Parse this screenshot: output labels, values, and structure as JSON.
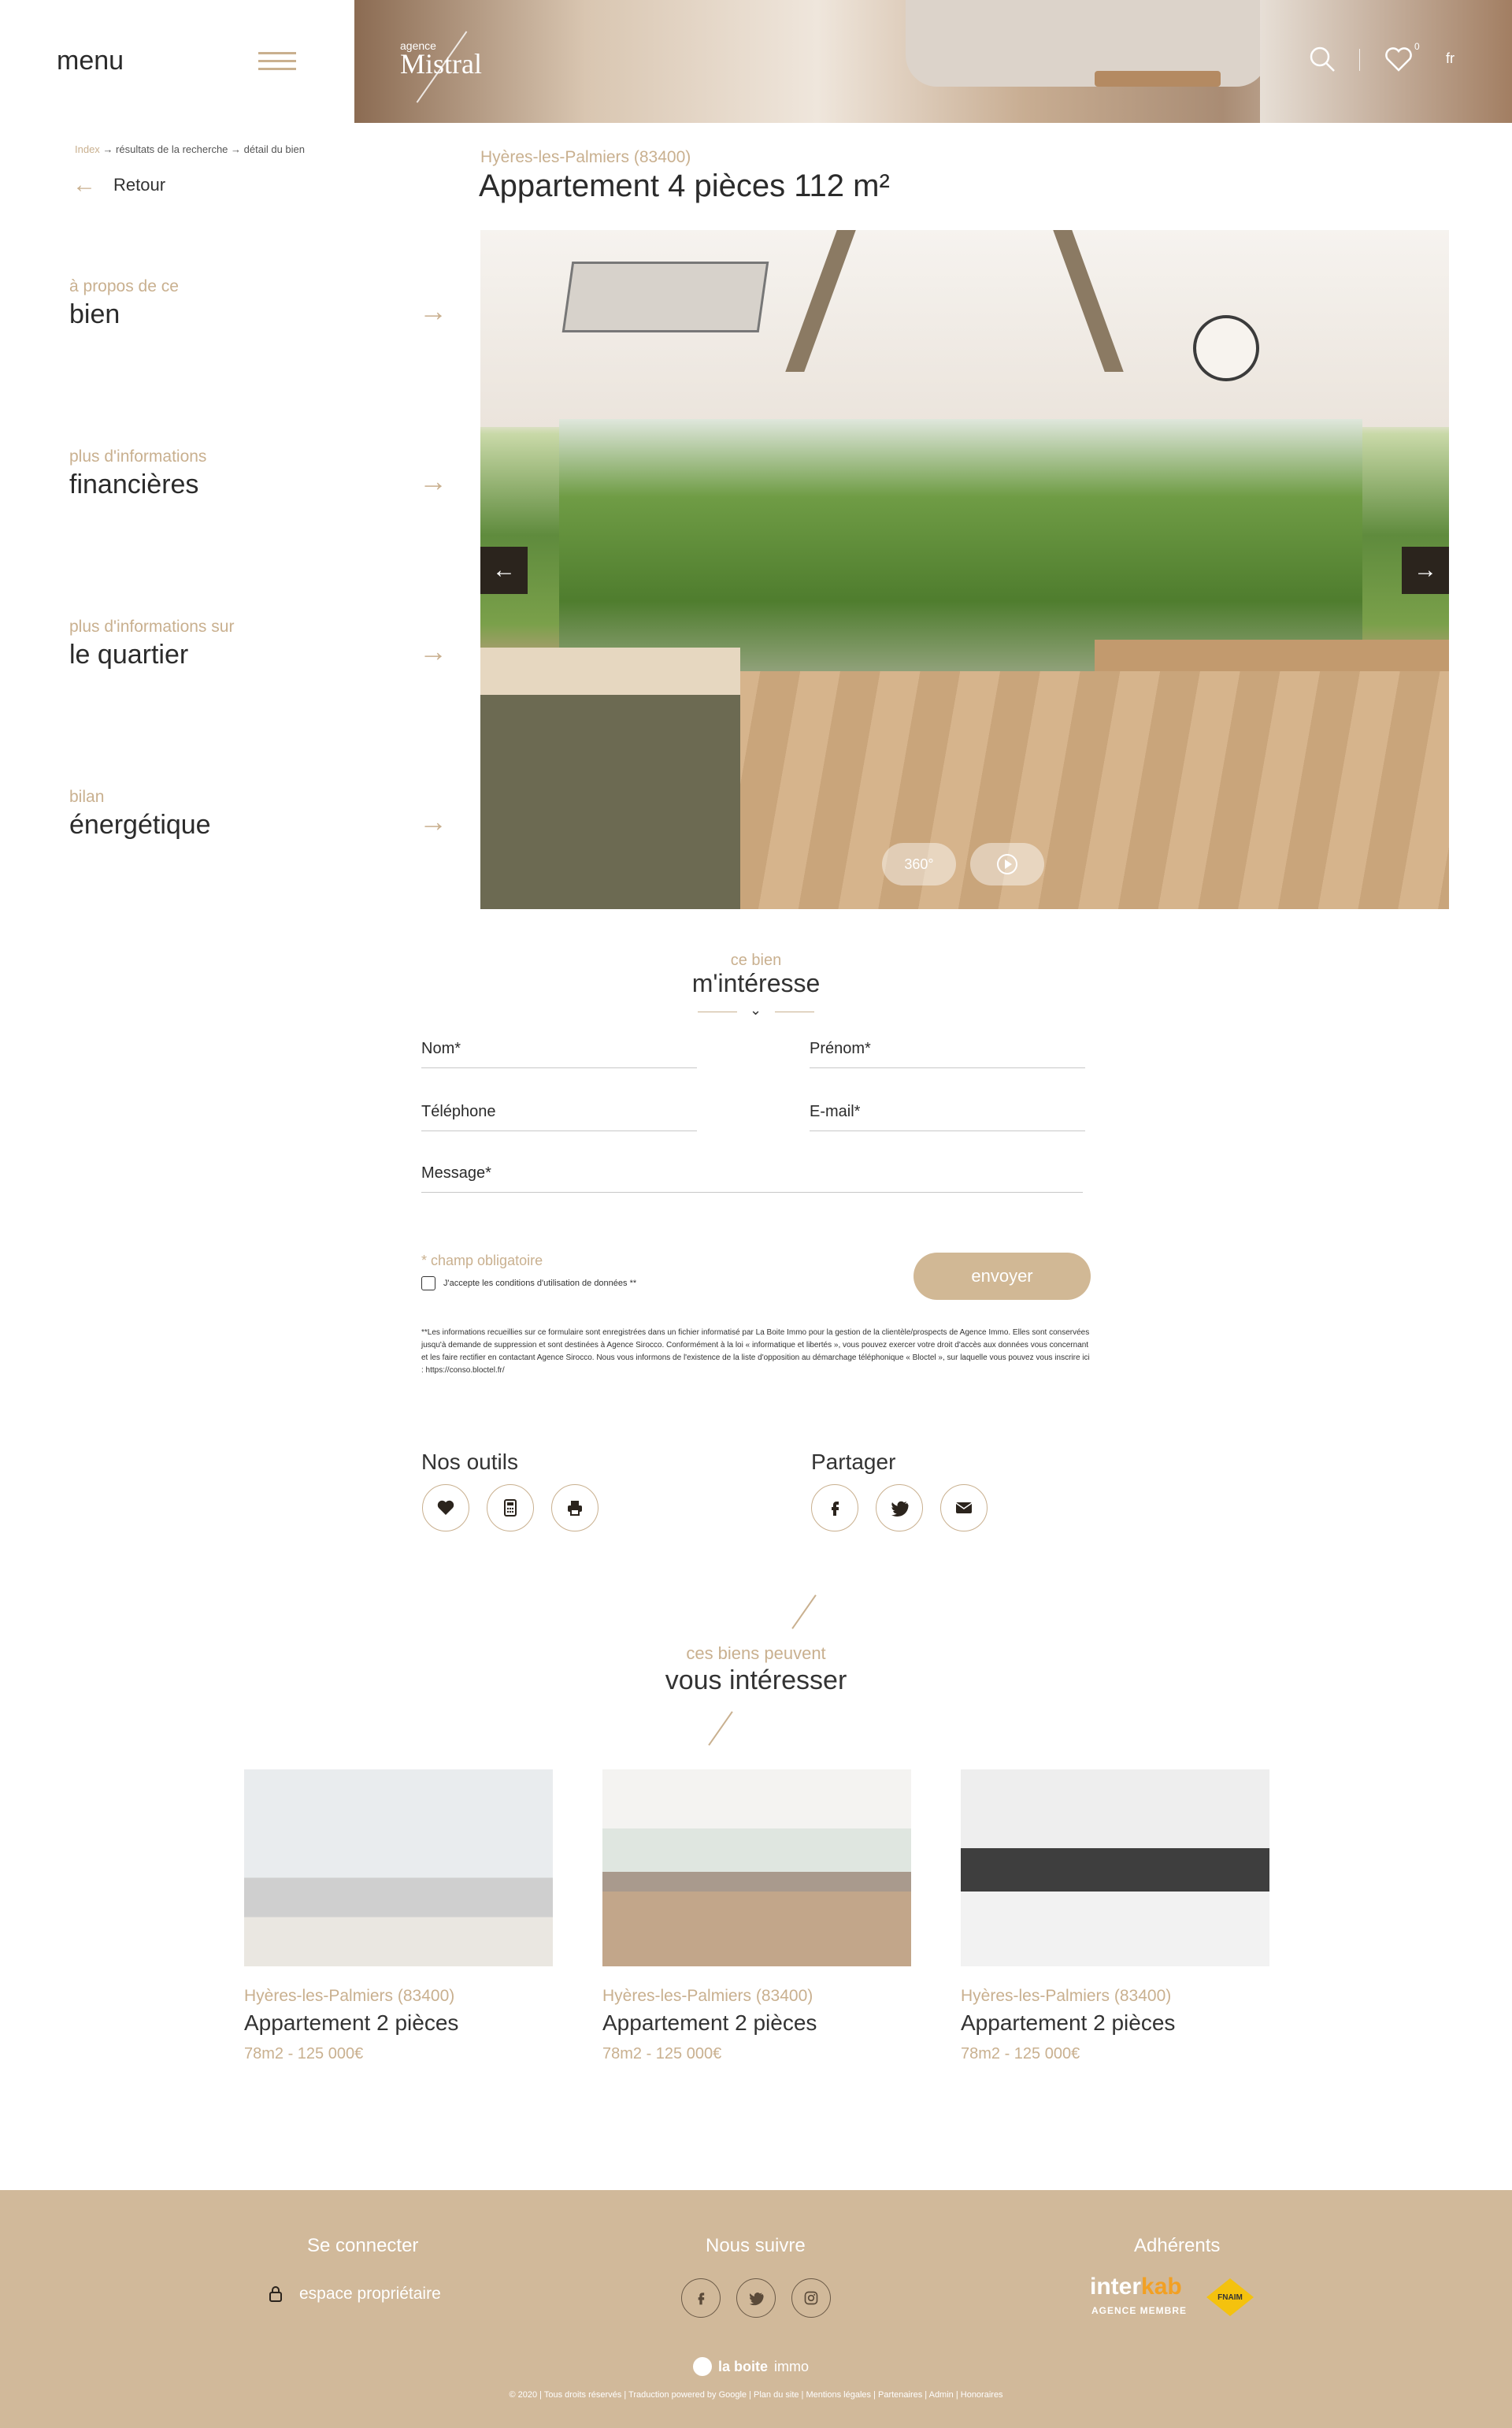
{
  "header": {
    "menu_label": "menu",
    "logo_small": "agence",
    "logo_main": "Mistral",
    "favorites_count": "0",
    "language": "fr"
  },
  "breadcrumb": {
    "home": "Index",
    "results": "→ résultats de la recherche",
    "detail": "→ détail du bien"
  },
  "back_label": "Retour",
  "sidebar": {
    "items": [
      {
        "small": "à propos de ce",
        "big": "bien"
      },
      {
        "small": "plus d'informations",
        "big": "financières"
      },
      {
        "small": "plus d'informations sur",
        "big": "le quartier"
      },
      {
        "small": "bilan",
        "big": "énergétique"
      }
    ]
  },
  "property": {
    "city": "Hyères-les-Palmiers (83400)",
    "title": "Appartement 4 pièces 112 m²"
  },
  "gallery": {
    "btn_360": "360°"
  },
  "contact": {
    "kicker": "ce bien",
    "title": "m'intéresse",
    "nom": "Nom*",
    "prenom": "Prénom*",
    "telephone": "Téléphone",
    "email": "E-mail*",
    "message": "Message*",
    "required_note": "* champ obligatoire",
    "consent": "J'accepte les conditions d'utilisation de données **",
    "submit": "envoyer",
    "legal": "**Les informations recueillies sur ce formulaire sont enregistrées dans un fichier informatisé par La Boite Immo pour la gestion de la clientèle/prospects de Agence Immo. Elles sont conservées jusqu'à demande de suppression et sont destinées à Agence Sirocco. Conformément à la loi « informatique et libertés », vous pouvez exercer votre droit d'accès aux données vous concernant et les faire rectifier en contactant Agence Sirocco. Nous vous informons de l'existence de la liste d'opposition au démarchage téléphonique « Bloctel », sur laquelle vous pouvez vous inscrire ici : https://conso.bloctel.fr/"
  },
  "tools": {
    "title": "Nos outils",
    "share_title": "Partager"
  },
  "suggestions": {
    "kicker": "ces biens peuvent",
    "title": "vous intéresser",
    "cards": [
      {
        "city": "Hyères-les-Palmiers (83400)",
        "title": "Appartement 2 pièces",
        "meta": "78m2 - 125 000€"
      },
      {
        "city": "Hyères-les-Palmiers (83400)",
        "title": "Appartement 2 pièces",
        "meta": "78m2 - 125 000€"
      },
      {
        "city": "Hyères-les-Palmiers (83400)",
        "title": "Appartement 2 pièces",
        "meta": "78m2 - 125 000€"
      }
    ]
  },
  "footer": {
    "connect_title": "Se connecter",
    "follow_title": "Nous suivre",
    "members_title": "Adhérents",
    "owner_link": "espace propriétaire",
    "interkab_a": "inter",
    "interkab_b": "kab",
    "interkab_sub": "AGENCE MEMBRE",
    "fnaim": "FNAIM",
    "laboite_a": "la boite",
    "laboite_b": "immo",
    "copyright": "© 2020 | Tous droits réservés | Traduction powered by Google | Plan du site | Mentions légales | Partenaires | Admin | Honoraires"
  },
  "colors": {
    "accent": "#c9b08f",
    "footer_bg": "#d1b99a",
    "submit_bg": "#d1b895"
  }
}
